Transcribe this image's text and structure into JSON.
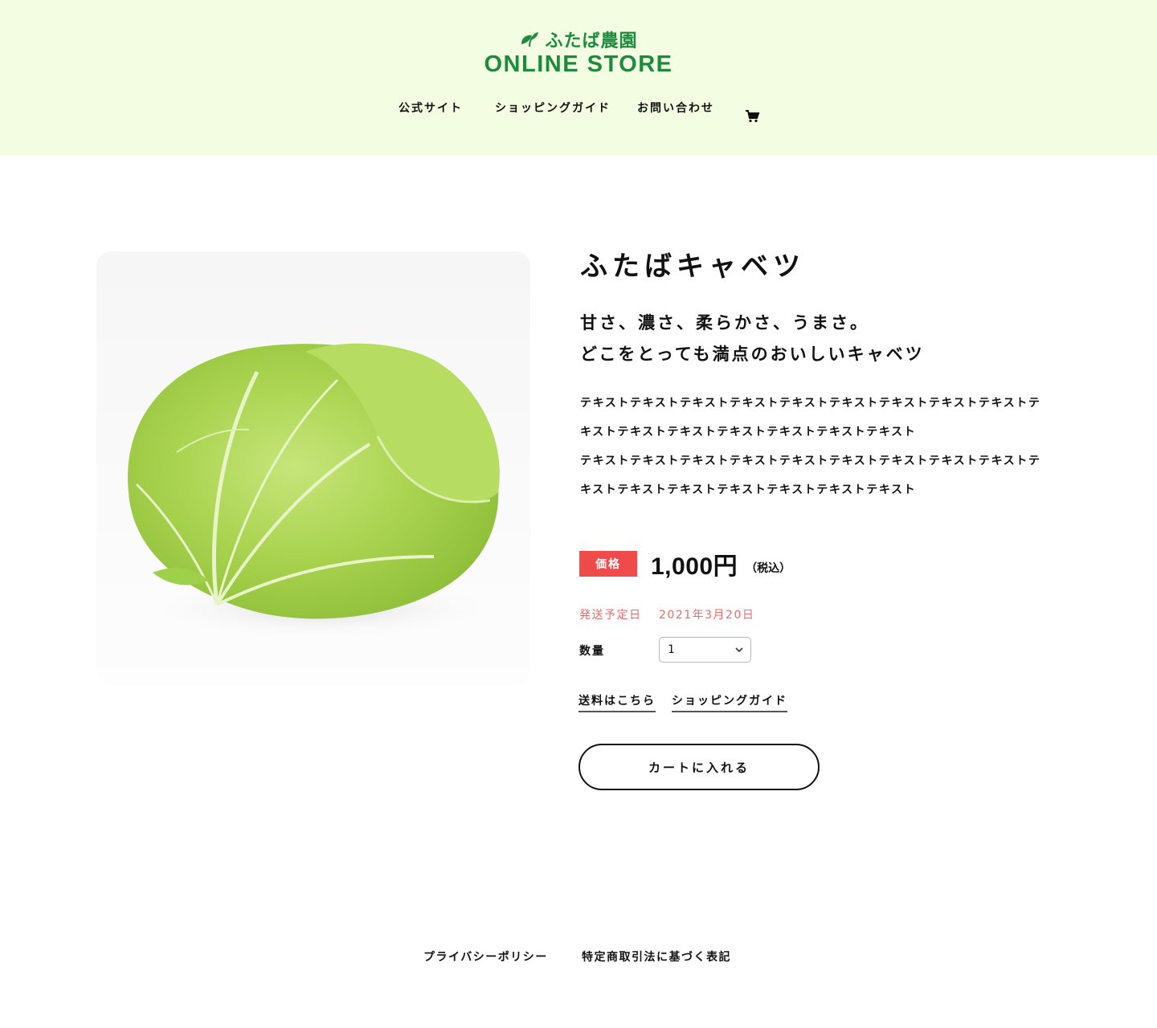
{
  "header": {
    "logo_top": "ふたば農園",
    "logo_bottom": "ONLINE STORE",
    "brand_color": "#1e8a3d",
    "background": "#f3fde1",
    "nav": [
      {
        "label": "公式サイト"
      },
      {
        "label": "ショッピングガイド"
      },
      {
        "label": "お問い合わせ"
      }
    ],
    "cart_icon": "cart-icon"
  },
  "product": {
    "image_subject": "cabbage",
    "title": "ふたばキャベツ",
    "catch_line_1": "甘さ、濃さ、柔らかさ、うまさ。",
    "catch_line_2": "どこをとっても満点のおいしいキャベツ",
    "description": [
      "テキストテキストテキストテキストテキストテキストテキストテキストテキストテ",
      "キストテキストテキストテキストテキストテキストテキスト",
      "テキストテキストテキストテキストテキストテキストテキストテキストテキストテ",
      "キストテキストテキストテキストテキストテキストテキスト"
    ],
    "price_badge": "価格",
    "price": "1,000円",
    "tax_note": "（税込）",
    "shipping_label": "発送予定日",
    "shipping_date": "2021年3月20日",
    "quantity_label": "数量",
    "quantity_value": "1",
    "links": {
      "shipping_fee": "送料はこちら",
      "shopping_guide": "ショッピングガイド"
    },
    "add_to_cart": "カートに入れる",
    "accent_color": "#f04a4a"
  },
  "footer": {
    "privacy": "プライバシーポリシー",
    "legal": "特定商取引法に基づく表記"
  }
}
